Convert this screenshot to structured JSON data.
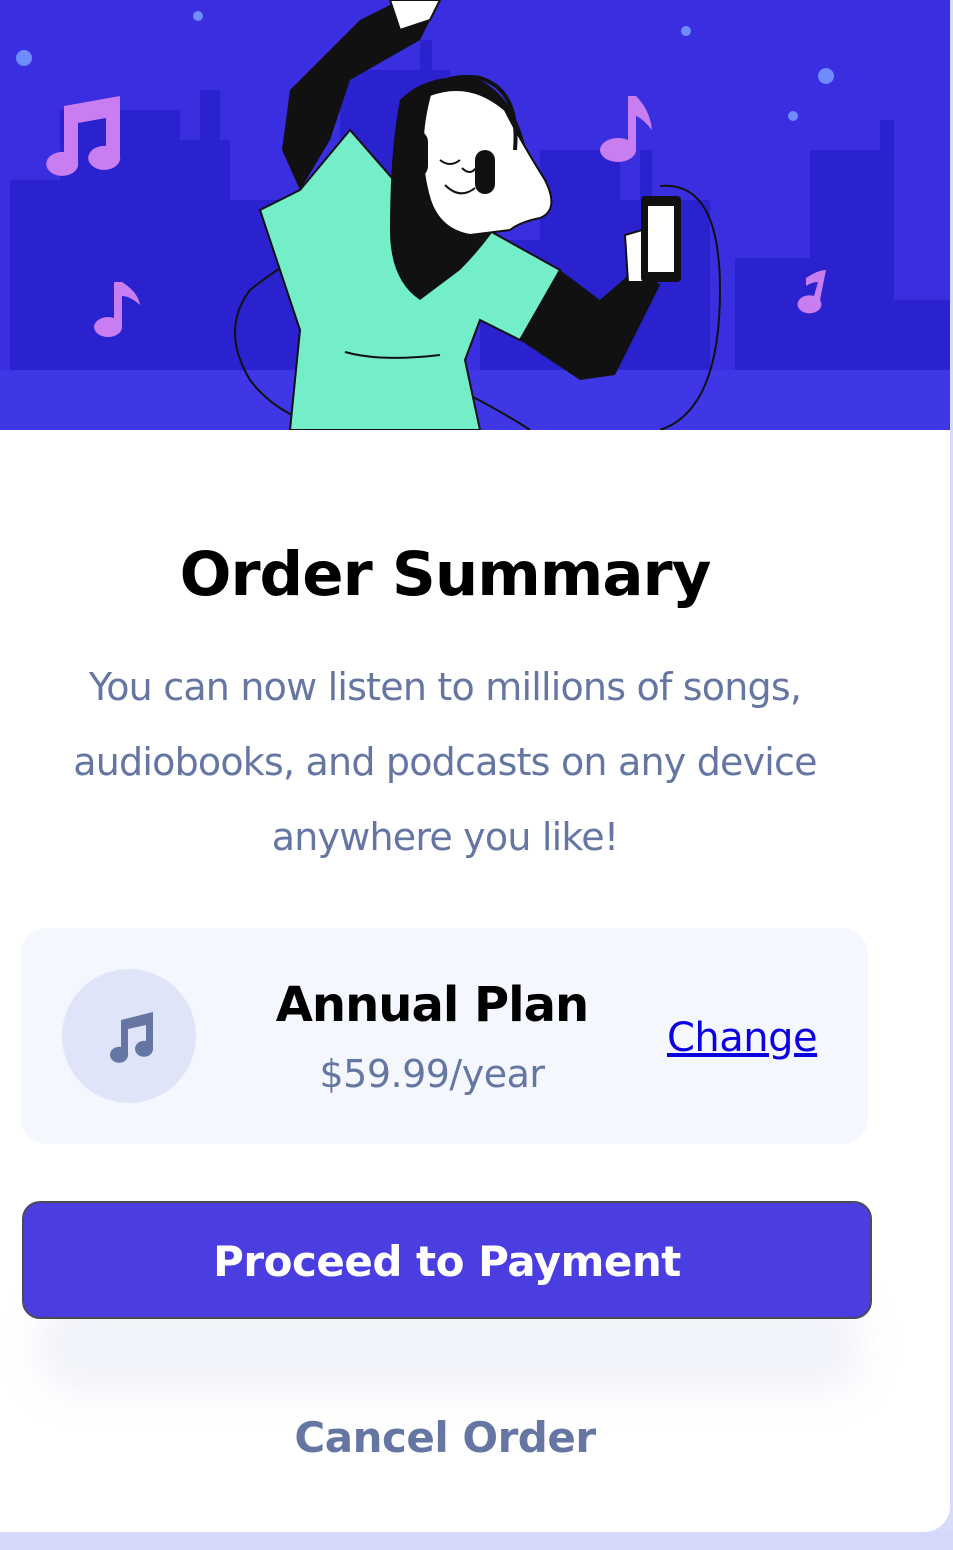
{
  "title": "Order Summary",
  "description": "You can now listen to millions of songs, audiobooks, and podcasts on any device anywhere you like!",
  "plan": {
    "icon": "music-note-icon",
    "name": "Annual Plan",
    "price": "$59.99/year",
    "change_label": "Change"
  },
  "actions": {
    "proceed_label": "Proceed to Payment",
    "cancel_label": "Cancel Order"
  },
  "colors": {
    "accent": "#4b3ee0",
    "hero_background": "#3a2fe0",
    "muted_text": "#6576a3",
    "link": "#0a00e0",
    "plan_box": "#f5f7fe"
  }
}
